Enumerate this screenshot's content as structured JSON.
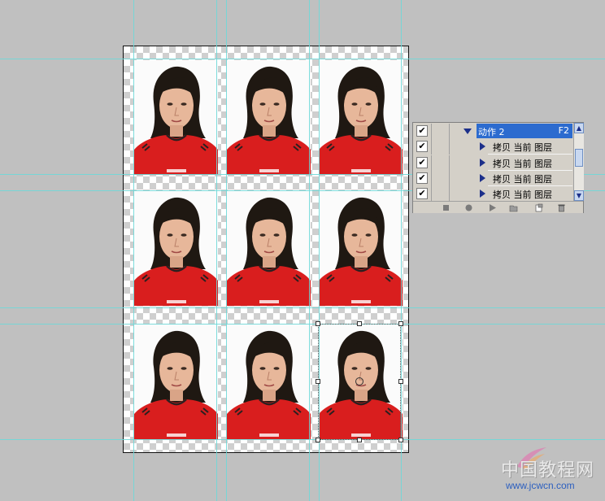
{
  "canvas": {
    "photo_grid": {
      "rows": 3,
      "cols": 3
    },
    "colors": {
      "background": "#c0c0c0",
      "guide": "#6fd8d8",
      "shirt": "#d91e1e",
      "skin": "#e7b79a",
      "hair": "#1f1812"
    }
  },
  "actions_panel": {
    "action_name": "动作 2",
    "action_shortcut": "F2",
    "steps": [
      "拷贝 当前 图层",
      "拷贝 当前 图层",
      "拷贝 当前 图层",
      "拷贝 当前 图层"
    ],
    "header_color": "#2c6bcf",
    "toolbar_icons": [
      "stop-icon",
      "record-icon",
      "play-icon",
      "new-set-icon",
      "new-action-icon",
      "delete-icon"
    ]
  },
  "watermark": {
    "chinese": "中国教程网",
    "url": "www.jcwcn.com"
  }
}
